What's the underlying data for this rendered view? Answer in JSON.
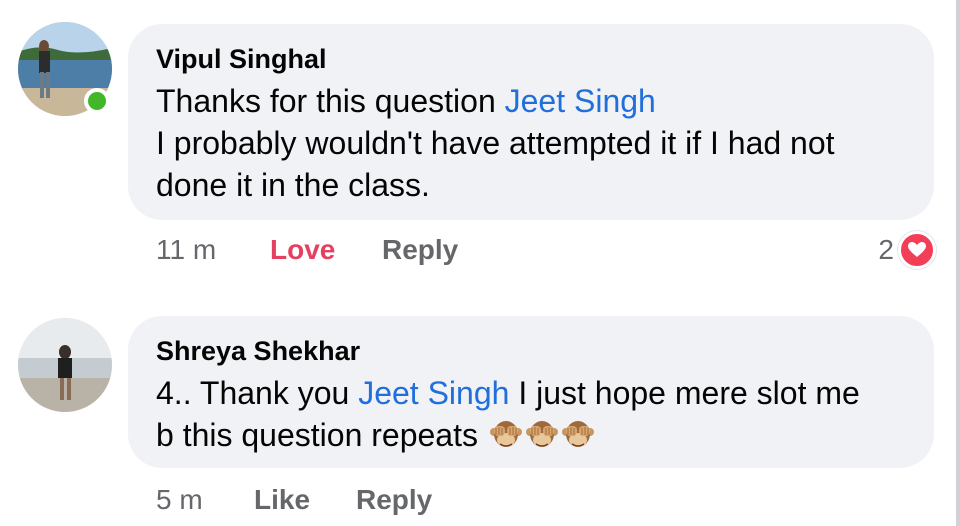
{
  "comments": [
    {
      "author": "Vipul Singhal",
      "text_before": "Thanks for this question ",
      "mention": "Jeet Singh",
      "text_after_line2": "I probably wouldn't have attempted it if I had not",
      "text_after_line3": "done it in the class.",
      "time": "11 m",
      "reaction_action": "Love",
      "reply_label": "Reply",
      "reaction_count": "2",
      "reaction_icon": "heart-icon",
      "online": true,
      "avatar_icon": "avatar-photo-lake"
    },
    {
      "author": "Shreya Shekhar",
      "text_before": "4.. Thank you ",
      "mention": "Jeet Singh",
      "text_after": " I just hope mere slot me",
      "text_line2": "b this question repeats",
      "emoji": "see-no-evil-monkey",
      "emoji_count": 3,
      "time": "5 m",
      "reaction_action": "Like",
      "reply_label": "Reply",
      "avatar_icon": "avatar-photo-beach"
    }
  ],
  "colors": {
    "bubble": "#f0f2f5",
    "mention": "#216fdb",
    "love": "#e4405f",
    "meta": "#65676b",
    "online": "#42b72a"
  }
}
